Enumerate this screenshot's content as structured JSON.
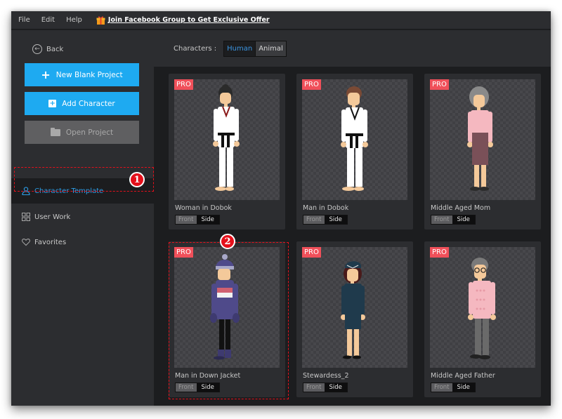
{
  "menubar": {
    "items": [
      "File",
      "Edit",
      "Help"
    ],
    "promo_icon": "gift-icon",
    "promo_text": "Join Facebook Group to Get Exclusive Offer"
  },
  "sidebar": {
    "back_label": "Back",
    "buttons": [
      {
        "label": "New Blank Project",
        "icon": "plus-icon",
        "state": "enabled"
      },
      {
        "label": "Add Character",
        "icon": "add-character-icon",
        "state": "enabled"
      },
      {
        "label": "Open Project",
        "icon": "folder-icon",
        "state": "disabled"
      }
    ],
    "nav": [
      {
        "label": "Character Template",
        "icon": "user-icon",
        "active": true
      },
      {
        "label": "User Work",
        "icon": "grid-icon",
        "active": false
      },
      {
        "label": "Favorites",
        "icon": "heart-icon",
        "active": false
      }
    ]
  },
  "filter": {
    "label": "Characters :",
    "options": [
      "Human",
      "Animal"
    ],
    "selected": "Human"
  },
  "cards": [
    {
      "name": "Woman in Dobok",
      "badge": "PRO",
      "front": "Front",
      "side": "Side"
    },
    {
      "name": "Man in Dobok",
      "badge": "PRO",
      "front": "Front",
      "side": "Side"
    },
    {
      "name": "Middle Aged Mom",
      "badge": "PRO",
      "front": "Front",
      "side": "Side"
    },
    {
      "name": "Man in Down Jacket",
      "badge": "PRO",
      "front": "Front",
      "side": "Side"
    },
    {
      "name": "Stewardess_2",
      "badge": "PRO",
      "front": "Front",
      "side": "Side"
    },
    {
      "name": "Middle Aged Father",
      "badge": "PRO",
      "front": "Front",
      "side": "Side"
    }
  ],
  "annotations": [
    {
      "number": "1",
      "target": "Character Template"
    },
    {
      "number": "2",
      "target": "Man in Down Jacket"
    }
  ],
  "colors": {
    "accent_blue": "#1eaaf1",
    "active_nav_text": "#2d9ee8",
    "pro_badge": "#f0505a",
    "annotation_red": "#e5101b",
    "window_bg": "#1c1d1f",
    "panel_bg": "#2c2d30"
  }
}
